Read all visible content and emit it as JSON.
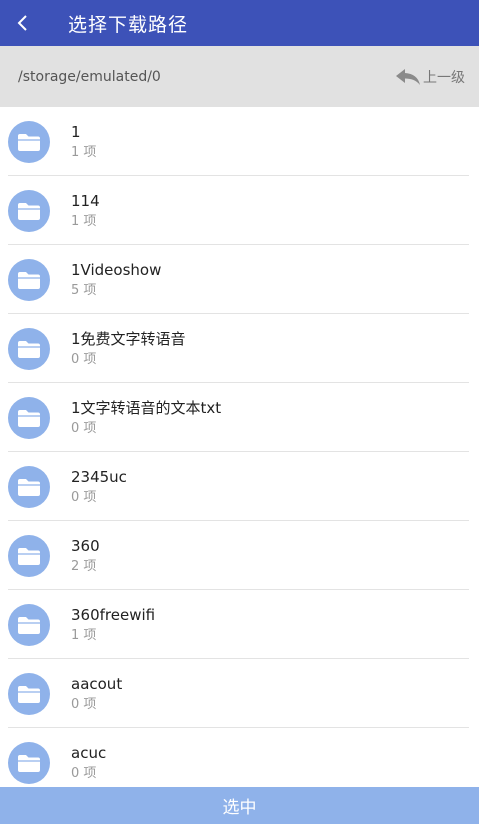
{
  "header": {
    "title": "选择下载路径",
    "back_icon": "chevron-left-icon",
    "background": "#3d52b8"
  },
  "pathbar": {
    "path": "/storage/emulated/0",
    "up_label": "上一级",
    "up_icon": "reply-arrow-icon"
  },
  "folders": [
    {
      "name": "1",
      "count": "1 项"
    },
    {
      "name": "114",
      "count": "1 项"
    },
    {
      "name": "1Videoshow",
      "count": "5 项"
    },
    {
      "name": "1免费文字转语音",
      "count": "0 项"
    },
    {
      "name": "1文字转语音的文本txt",
      "count": "0 项"
    },
    {
      "name": "2345uc",
      "count": "0 项"
    },
    {
      "name": "360",
      "count": "2 项"
    },
    {
      "name": "360freewifi",
      "count": "1 项"
    },
    {
      "name": "aacout",
      "count": "0 项"
    },
    {
      "name": "acuc",
      "count": "0 项"
    }
  ],
  "folder_icon": "folder-icon",
  "select_button": {
    "label": "选中",
    "color": "#8fb2ea"
  }
}
